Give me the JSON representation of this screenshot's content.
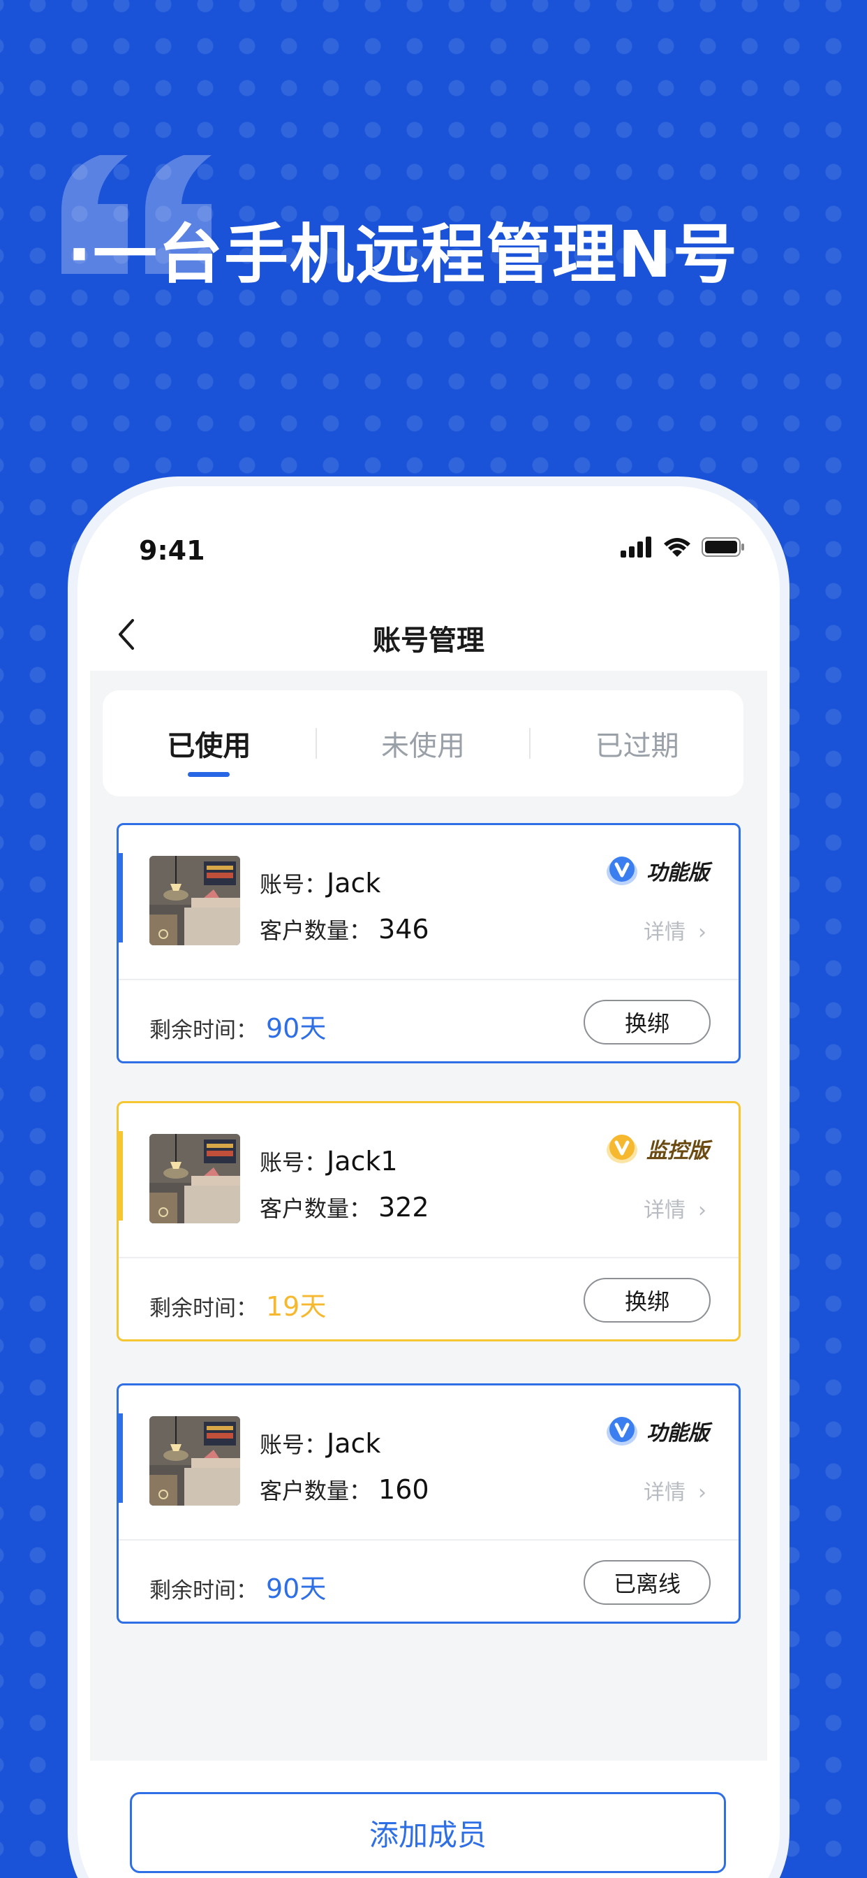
{
  "promo": {
    "headline": "·一台手机远程管理N号",
    "quote_icon": "quote-mark-icon"
  },
  "status_bar": {
    "time": "9:41",
    "icons": [
      "signal-icon",
      "wifi-icon",
      "battery-icon"
    ]
  },
  "nav": {
    "back_icon": "back-chevron-icon",
    "title": "账号管理"
  },
  "tabs": [
    {
      "label": "已使用",
      "active": true
    },
    {
      "label": "未使用",
      "active": false
    },
    {
      "label": "已过期",
      "active": false
    }
  ],
  "labels": {
    "account": "账号：",
    "customer_count": "客户数量：",
    "remaining_time": "剩余时间：",
    "details": "详情"
  },
  "accounts": [
    {
      "account": "Jack",
      "customer_count": "346",
      "edition": "功能版",
      "edition_color": "#3b7ef0",
      "remaining": "90天",
      "action": "换绑"
    },
    {
      "account": "Jack1",
      "customer_count": "322",
      "edition": "监控版",
      "edition_color": "#f5b82e",
      "remaining": "19天",
      "action": "换绑"
    },
    {
      "account": "Jack",
      "customer_count": "160",
      "edition": "功能版",
      "edition_color": "#3b7ef0",
      "remaining": "90天",
      "action": "已离线"
    }
  ],
  "footer": {
    "add_member": "添加成员"
  },
  "colors": {
    "background": "#1a53d8",
    "accent_blue": "#2f6fe5",
    "accent_gold": "#f5c532"
  }
}
